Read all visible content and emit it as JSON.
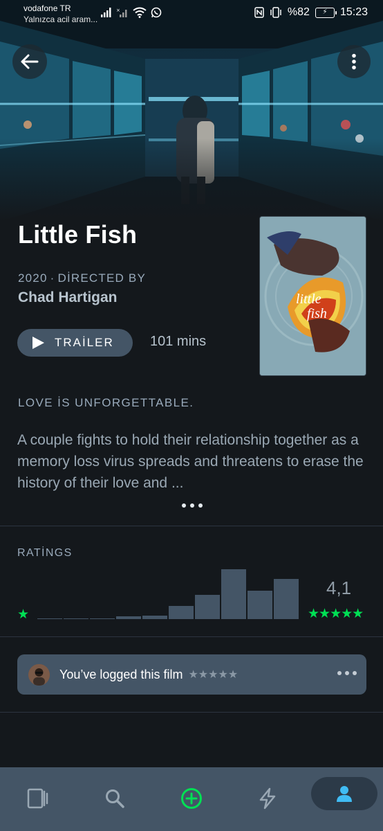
{
  "status_bar": {
    "carrier": "vodafone TR",
    "carrier_sub": "Yalnızca acil aram...",
    "battery": "%82",
    "time": "15:23"
  },
  "film": {
    "title": "Little Fish",
    "year": "2020",
    "directed_by_label": "DİRECTED BY",
    "director": "Chad Hartigan",
    "trailer_label": "TRAİLER",
    "runtime": "101 mins",
    "poster_title_line1": "little",
    "poster_title_line2": "fish",
    "tagline": "LOVE İS UNFORGETTABLE.",
    "synopsis": "A couple fights to hold their relationship together as a memory loss virus spreads and threatens to erase the history of their love and ..."
  },
  "ratings": {
    "label": "RATİNGS",
    "average": "4,1",
    "min_label": "★",
    "max_label": "★★★★★",
    "histogram": [
      0.02,
      0.02,
      0.02,
      0.05,
      0.07,
      0.27,
      0.48,
      1.0,
      0.57,
      0.81
    ]
  },
  "log": {
    "text": "You’ve logged this film",
    "stars": "★★★★★"
  },
  "colors": {
    "background": "#14181c",
    "surface": "#445566",
    "accent_green": "#00e054",
    "text_muted": "#99aabb"
  },
  "nav": {
    "items": [
      "films-icon",
      "search-icon",
      "add-icon",
      "activity-icon",
      "profile-icon"
    ],
    "active": "profile-icon"
  }
}
